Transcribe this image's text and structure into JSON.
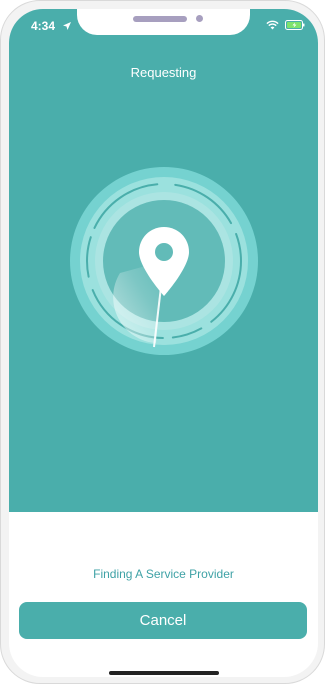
{
  "status_bar": {
    "time": "4:34"
  },
  "header": {
    "title": "Requesting"
  },
  "radar": {
    "icon": "location-pin-icon"
  },
  "footer": {
    "status_text": "Finding A Service Provider",
    "cancel_label": "Cancel"
  },
  "colors": {
    "primary": "#4aaeab",
    "accent_text": "#3fa2a6",
    "background": "#ffffff"
  }
}
